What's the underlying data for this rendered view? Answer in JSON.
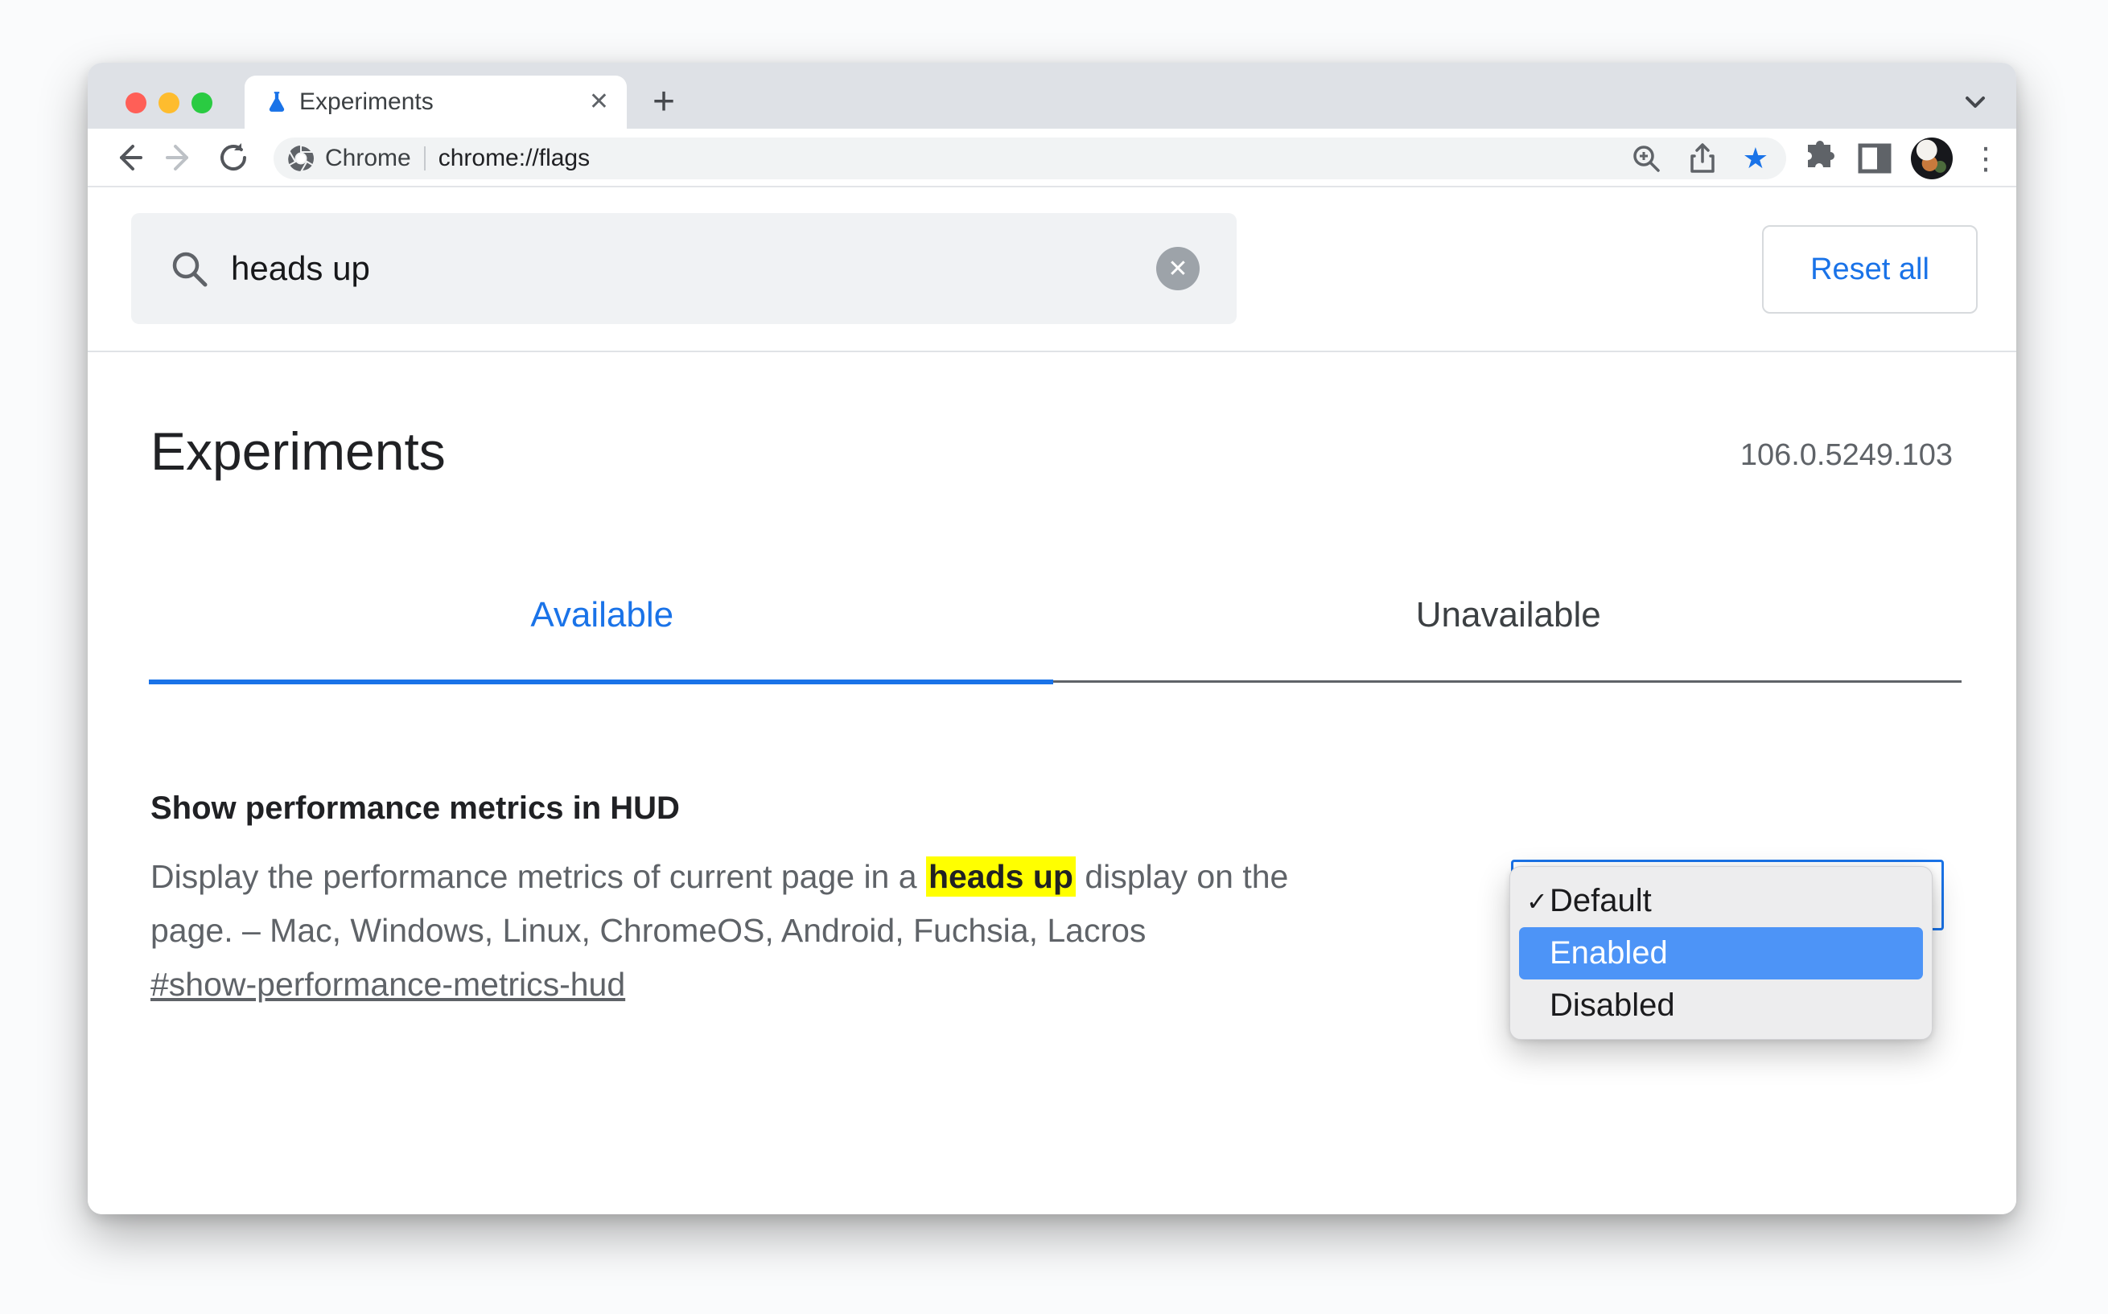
{
  "colors": {
    "accent_blue": "#1a73e8",
    "selection_blue": "#4d94f7",
    "highlight_yellow": "#ffff00",
    "traffic_red": "#ff5f57",
    "traffic_yellow": "#febc2e",
    "traffic_green": "#2acb42",
    "tabstrip_grey": "#dee1e6"
  },
  "icons": {
    "close": "✕",
    "new_tab": "+",
    "overflow_menu": "⋮",
    "bookmark_star": "★",
    "check": "✓",
    "clear": "✕"
  },
  "browser": {
    "tab": {
      "title": "Experiments"
    },
    "address_bar": {
      "site": "Chrome",
      "url": "chrome://flags"
    }
  },
  "page": {
    "search": {
      "value": "heads up"
    },
    "reset_button": "Reset all",
    "title": "Experiments",
    "version": "106.0.5249.103",
    "tabs": [
      {
        "label": "Available",
        "active": true
      },
      {
        "label": "Unavailable",
        "active": false
      }
    ],
    "flag": {
      "name": "Show performance metrics in HUD",
      "description": {
        "line1_before": "Display the performance metrics of current page in a ",
        "highlight": "heads up",
        "line1_after": " display on the",
        "line2": "page. – Mac, Windows, Linux, ChromeOS, Android, Fuchsia, Lacros"
      },
      "permalink": "#show-performance-metrics-hud",
      "dropdown": {
        "options": [
          {
            "label": "Default",
            "checked": true,
            "highlighted": false
          },
          {
            "label": "Enabled",
            "checked": false,
            "highlighted": true
          },
          {
            "label": "Disabled",
            "checked": false,
            "highlighted": false
          }
        ]
      }
    }
  }
}
